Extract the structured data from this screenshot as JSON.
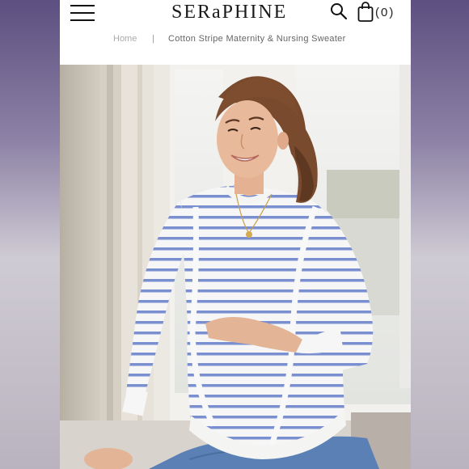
{
  "header": {
    "logo": "SERaPHINE",
    "bag_count": "(0)"
  },
  "breadcrumb": {
    "home": "Home",
    "separator": "|",
    "current": "Cotton Stripe Maternity & Nursing Sweater"
  },
  "icons": {
    "menu": "hamburger-menu-icon",
    "search": "search-icon",
    "bag": "shopping-bag-icon"
  },
  "colors": {
    "stripe": "#7a8fd0",
    "sweater": "#f6f6f6",
    "jeans": "#5b80b5",
    "hair": "#7a4a2e"
  }
}
